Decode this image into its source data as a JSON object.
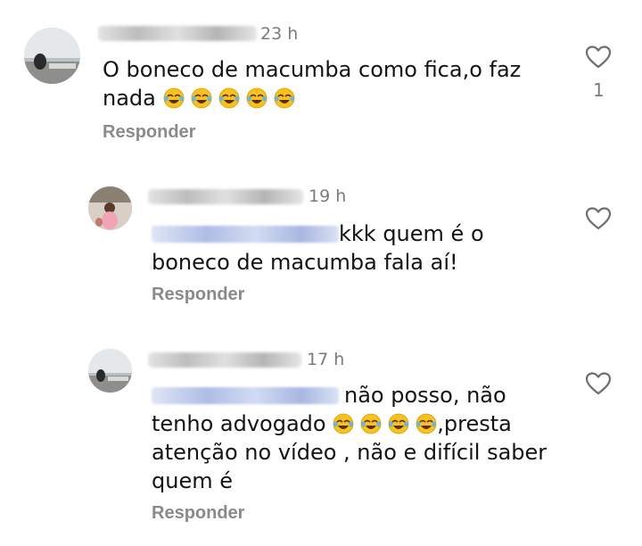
{
  "comments": [
    {
      "time": "23 h",
      "text_before": "O boneco de macumba como fica,o faz nada ",
      "emoji_count": 5,
      "emoji_name": "tears-of-joy-emoji",
      "text_after": "",
      "reply_label": "Responder",
      "likes": "1"
    },
    {
      "time": "19 h",
      "text_before": "kkk quem é o boneco de macumba fala aí!",
      "reply_label": "Responder"
    },
    {
      "time": "17 h",
      "line1": "não posso, não",
      "line2_before": "tenho advogado ",
      "emoji_count": 4,
      "emoji_name": "tears-of-joy-emoji",
      "line2_after": ",presta",
      "line3": "atenção no vídeo , não e difícil saber",
      "line4": "quem é",
      "reply_label": "Responder"
    }
  ],
  "colors": {
    "text": "#141414",
    "meta": "#7b7b7b",
    "reply": "#8a8a8a",
    "emoji_face": "#f7c21c"
  }
}
